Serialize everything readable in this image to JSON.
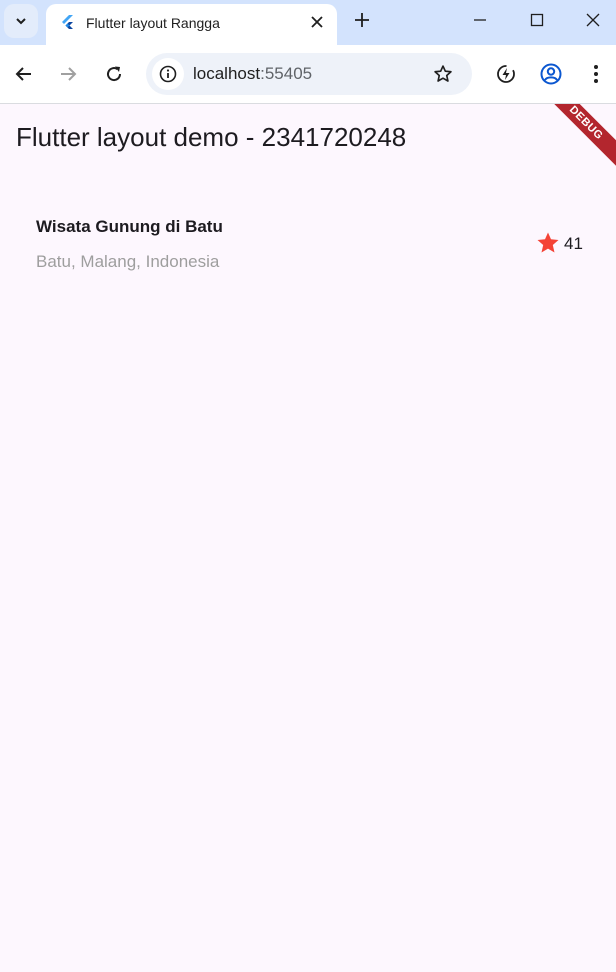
{
  "tab": {
    "title": "Flutter layout Rangga"
  },
  "address": {
    "host": "localhost",
    "port": ":55405"
  },
  "app": {
    "title": "Flutter layout demo - 2341720248",
    "debug_banner": "DEBUG"
  },
  "card": {
    "title": "Wisata Gunung di Batu",
    "subtitle": "Batu, Malang, Indonesia",
    "rating": "41",
    "star_color": "#f44336"
  },
  "icons": {
    "tab_search": "chevron-down-icon",
    "favicon": "flutter-icon",
    "tab_close": "close-icon",
    "new_tab": "plus-icon",
    "minimize": "minimize-icon",
    "maximize": "maximize-icon",
    "window_close": "close-icon",
    "back": "arrow-left-icon",
    "forward": "arrow-right-icon",
    "reload": "reload-icon",
    "site_info": "info-icon",
    "bookmark": "star-outline-icon",
    "performance": "lightning-icon",
    "profile": "profile-icon",
    "menu": "more-vert-icon",
    "rating_star": "star-icon"
  }
}
